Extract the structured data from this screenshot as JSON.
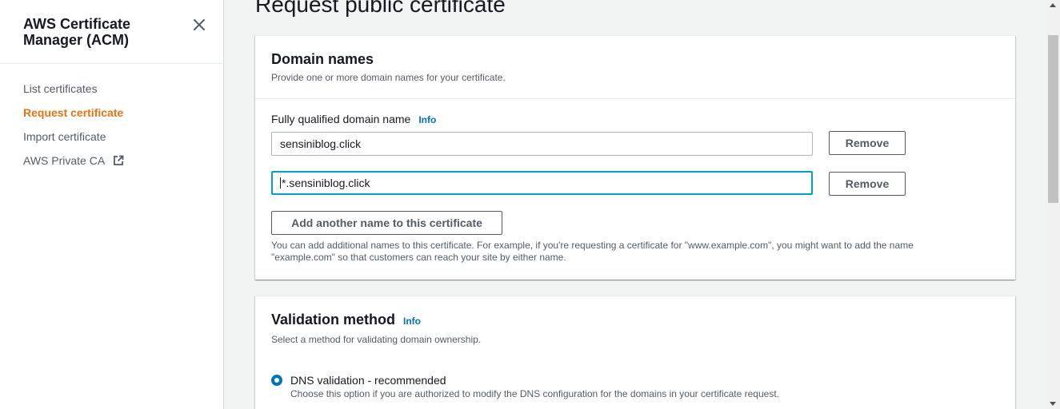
{
  "sidebar": {
    "title": "AWS Certificate Manager (ACM)",
    "items": [
      {
        "label": "List certificates"
      },
      {
        "label": "Request certificate"
      },
      {
        "label": "Import certificate"
      },
      {
        "label": "AWS Private CA"
      }
    ]
  },
  "main": {
    "page_title": "Request public certificate",
    "domain_panel": {
      "title": "Domain names",
      "description": "Provide one or more domain names for your certificate.",
      "field_label": "Fully qualified domain name",
      "info": "Info",
      "domains": [
        {
          "value": "sensiniblog.click",
          "remove_label": "Remove"
        },
        {
          "value": "*.sensiniblog.click",
          "remove_label": "Remove"
        }
      ],
      "add_button": "Add another name to this certificate",
      "help_text": "You can add additional names to this certificate. For example, if you're requesting a certificate for \"www.example.com\", you might want to add the name \"example.com\" so that customers can reach your site by either name."
    },
    "validation_panel": {
      "title": "Validation method",
      "info": "Info",
      "description": "Select a method for validating domain ownership.",
      "option_label": "DNS validation - recommended",
      "option_description": "Choose this option if you are authorized to modify the DNS configuration for the domains in your certificate request."
    }
  },
  "colors": {
    "accent_orange": "#ec7211",
    "link_blue": "#0073bb",
    "focus_border": "#00a1c9"
  }
}
